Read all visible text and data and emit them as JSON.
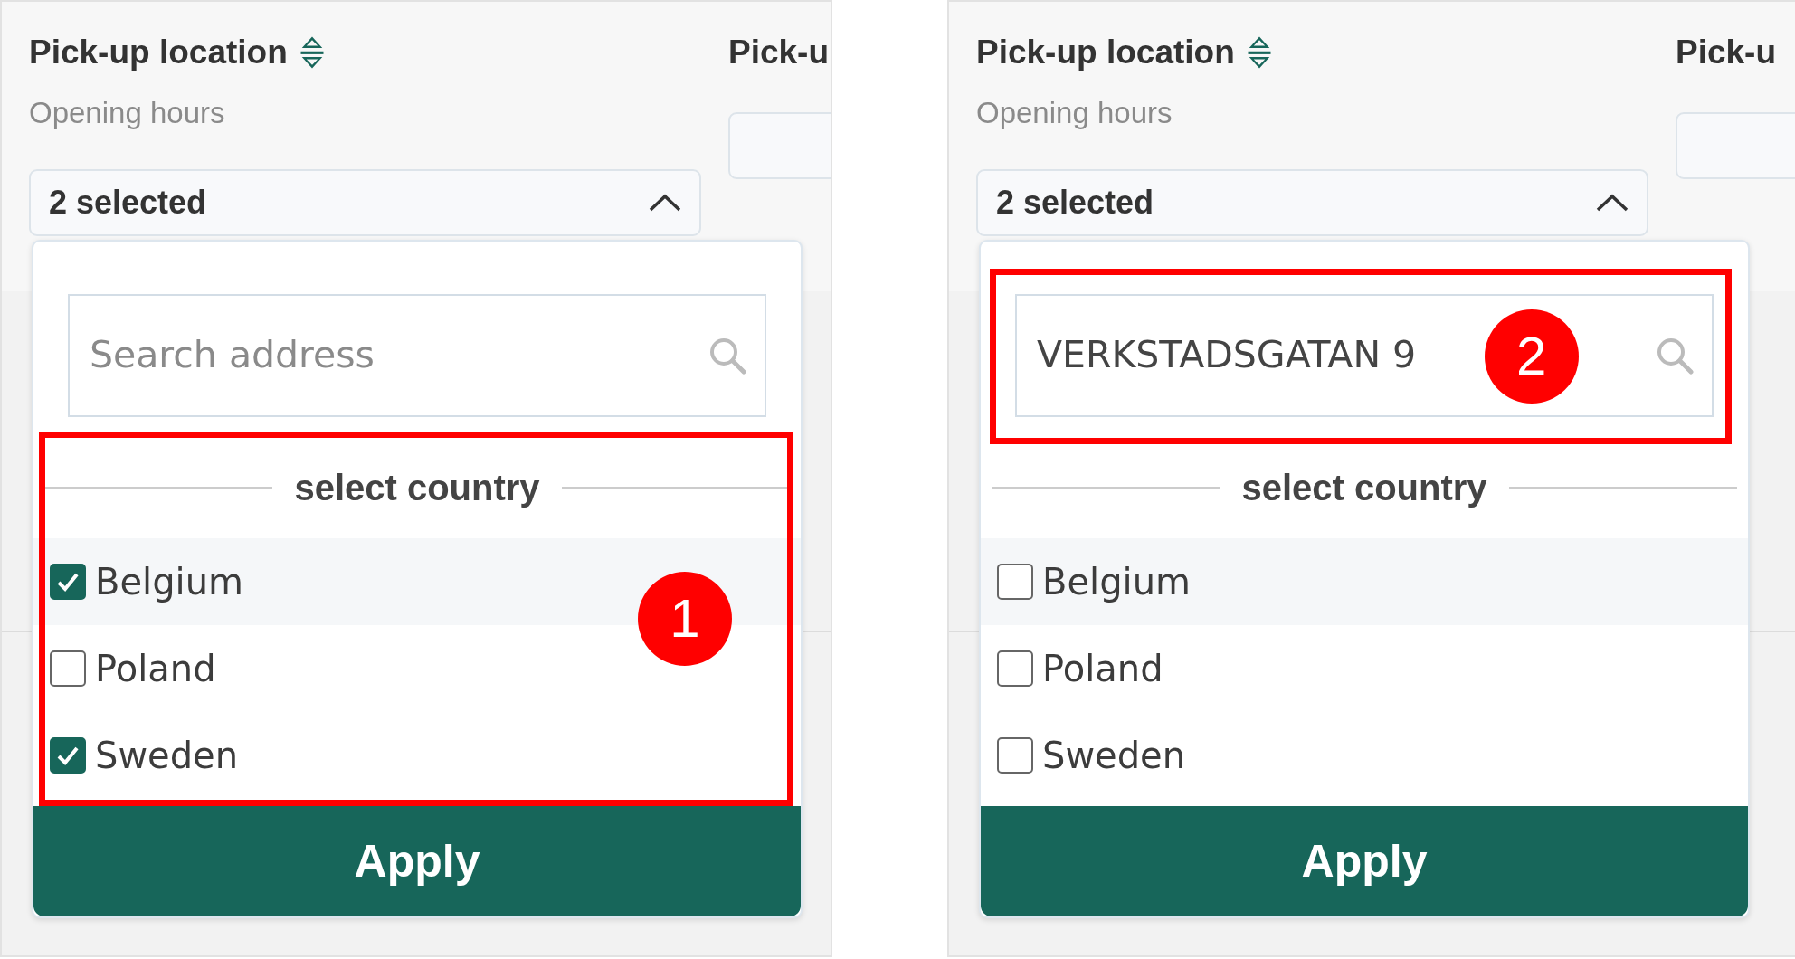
{
  "panels": [
    {
      "header": {
        "title": "Pick-up location",
        "subtitle": "Opening hours",
        "next_column": "Pick-u"
      },
      "dropdown": {
        "value": "2 selected",
        "expanded": true
      },
      "search": {
        "placeholder": "Search address"
      },
      "section_label": "select country",
      "country_list": {
        "annotation": "1",
        "items": [
          {
            "label": "Belgium",
            "checked": true,
            "hovered": true
          },
          {
            "label": "Poland",
            "checked": false,
            "hovered": false
          },
          {
            "label": "Sweden",
            "checked": true,
            "hovered": false
          }
        ]
      },
      "apply_button": "Apply"
    },
    {
      "header": {
        "title": "Pick-up location",
        "subtitle": "Opening hours",
        "next_column": "Pick-u"
      },
      "dropdown": {
        "value": "2 selected",
        "expanded": true
      },
      "search": {
        "value": "VERKSTADSGATAN 9",
        "annotation": "2"
      },
      "section_label": "select country",
      "country_list": {
        "items": [
          {
            "label": "Belgium",
            "checked": false,
            "hovered": true
          },
          {
            "label": "Poland",
            "checked": false,
            "hovered": false
          },
          {
            "label": "Sweden",
            "checked": false,
            "hovered": false
          }
        ]
      },
      "apply_button": "Apply"
    }
  ]
}
